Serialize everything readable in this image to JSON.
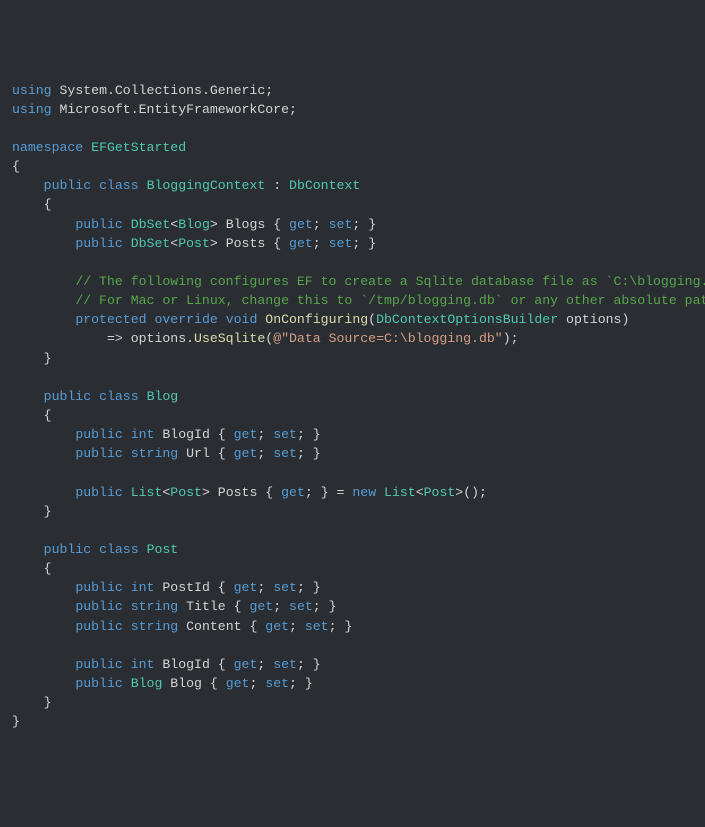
{
  "line1": {
    "kw1": "using",
    "ns": "System.Collections.Generic",
    "semi": ";"
  },
  "line2": {
    "kw1": "using",
    "ns": "Microsoft.EntityFrameworkCore",
    "semi": ";"
  },
  "line4": {
    "kw": "namespace",
    "name": "EFGetStarted"
  },
  "line5": {
    "brace": "{"
  },
  "line6": {
    "mod": "public",
    "kw": "class",
    "name": "BloggingContext",
    "colon": " : ",
    "base": "DbContext"
  },
  "line7": {
    "brace": "    {"
  },
  "line8": {
    "mod": "public",
    "type1": "DbSet",
    "lt": "<",
    "gen": "Blog",
    "gt": ">",
    "name": "Blogs",
    "ob": " { ",
    "get": "get",
    "s1": "; ",
    "set": "set",
    "s2": "; ",
    "cb": "}"
  },
  "line9": {
    "mod": "public",
    "type1": "DbSet",
    "lt": "<",
    "gen": "Post",
    "gt": ">",
    "name": "Posts",
    "ob": " { ",
    "get": "get",
    "s1": "; ",
    "set": "set",
    "s2": "; ",
    "cb": "}"
  },
  "line11": {
    "text": "// The following configures EF to create a Sqlite database file as `C:\\blogging.db"
  },
  "line12": {
    "text": "// For Mac or Linux, change this to `/tmp/blogging.db` or any other absolute path."
  },
  "line13": {
    "mod1": "protected",
    "mod2": "override",
    "ret": "void",
    "method": "OnConfiguring",
    "op": "(",
    "ptype": "DbContextOptionsBuilder",
    "pname": " options",
    "cp": ")"
  },
  "line14": {
    "arrow": "=> ",
    "obj": "options.",
    "method": "UseSqlite",
    "op": "(",
    "at": "@",
    "str": "\"Data Source=C:\\blogging.db\"",
    "cp": ");"
  },
  "line15": {
    "brace": "    }"
  },
  "line17": {
    "mod": "public",
    "kw": "class",
    "name": "Blog"
  },
  "line18": {
    "brace": "    {"
  },
  "line19": {
    "mod": "public",
    "type": "int",
    "name": "BlogId",
    "ob": " { ",
    "get": "get",
    "s1": "; ",
    "set": "set",
    "s2": "; ",
    "cb": "}"
  },
  "line20": {
    "mod": "public",
    "type": "string",
    "name": "Url",
    "ob": " { ",
    "get": "get",
    "s1": "; ",
    "set": "set",
    "s2": "; ",
    "cb": "}"
  },
  "line22": {
    "mod": "public",
    "type1": "List",
    "lt": "<",
    "gen": "Post",
    "gt": ">",
    "name": "Posts",
    "ob": " { ",
    "get": "get",
    "s1": "; ",
    "cb": "}",
    "eq": " = ",
    "new": "new",
    "type2": "List",
    "lt2": "<",
    "gen2": "Post",
    "gt2": ">",
    "paren": "();"
  },
  "line23": {
    "brace": "    }"
  },
  "line25": {
    "mod": "public",
    "kw": "class",
    "name": "Post"
  },
  "line26": {
    "brace": "    {"
  },
  "line27": {
    "mod": "public",
    "type": "int",
    "name": "PostId",
    "ob": " { ",
    "get": "get",
    "s1": "; ",
    "set": "set",
    "s2": "; ",
    "cb": "}"
  },
  "line28": {
    "mod": "public",
    "type": "string",
    "name": "Title",
    "ob": " { ",
    "get": "get",
    "s1": "; ",
    "set": "set",
    "s2": "; ",
    "cb": "}"
  },
  "line29": {
    "mod": "public",
    "type": "string",
    "name": "Content",
    "ob": " { ",
    "get": "get",
    "s1": "; ",
    "set": "set",
    "s2": "; ",
    "cb": "}"
  },
  "line31": {
    "mod": "public",
    "type": "int",
    "name": "BlogId",
    "ob": " { ",
    "get": "get",
    "s1": "; ",
    "set": "set",
    "s2": "; ",
    "cb": "}"
  },
  "line32": {
    "mod": "public",
    "type": "Blog",
    "name": "Blog",
    "ob": " { ",
    "get": "get",
    "s1": "; ",
    "set": "set",
    "s2": "; ",
    "cb": "}"
  },
  "line33": {
    "brace": "    }"
  },
  "line34": {
    "brace": "}"
  }
}
